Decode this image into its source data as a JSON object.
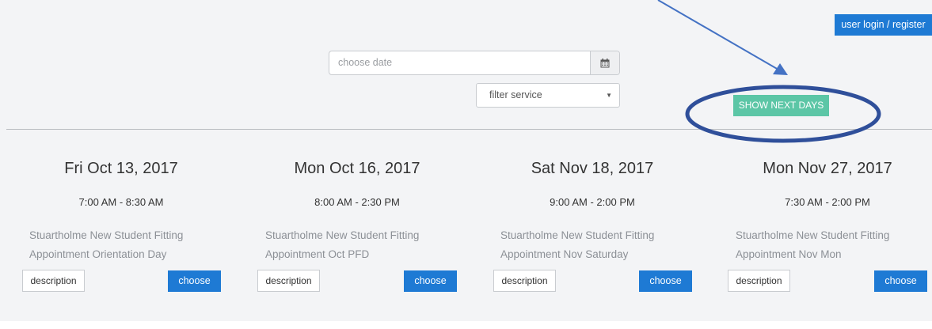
{
  "header": {
    "login_label": "user login / register",
    "show_next_days_label": "SHOW NEXT DAYS"
  },
  "filters": {
    "date_placeholder": "choose date",
    "date_icon": "calendar-icon",
    "service_select_value": "filter service",
    "service_select_icon": "caret-down-icon"
  },
  "annotation_color": "#2f4f9a",
  "accent_color": "#1e7ad4",
  "show_next_color": "#5cc6a6",
  "days": [
    {
      "date": "Fri Oct 13, 2017",
      "time": "7:00 AM - 8:30 AM",
      "title_line1": "Stuartholme New Student Fitting",
      "title_line2": "Appointment Orientation Day",
      "description_label": "description",
      "choose_label": "choose"
    },
    {
      "date": "Mon Oct 16, 2017",
      "time": "8:00 AM - 2:30 PM",
      "title_line1": "Stuartholme New Student Fitting",
      "title_line2": "Appointment Oct PFD",
      "description_label": "description",
      "choose_label": "choose"
    },
    {
      "date": "Sat Nov 18, 2017",
      "time": "9:00 AM - 2:00 PM",
      "title_line1": "Stuartholme New Student Fitting",
      "title_line2": "Appointment Nov Saturday",
      "description_label": "description",
      "choose_label": "choose"
    },
    {
      "date": "Mon Nov 27, 2017",
      "time": "7:30 AM - 2:00 PM",
      "title_line1": "Stuartholme New Student Fitting",
      "title_line2": "Appointment Nov Mon",
      "description_label": "description",
      "choose_label": "choose"
    }
  ]
}
